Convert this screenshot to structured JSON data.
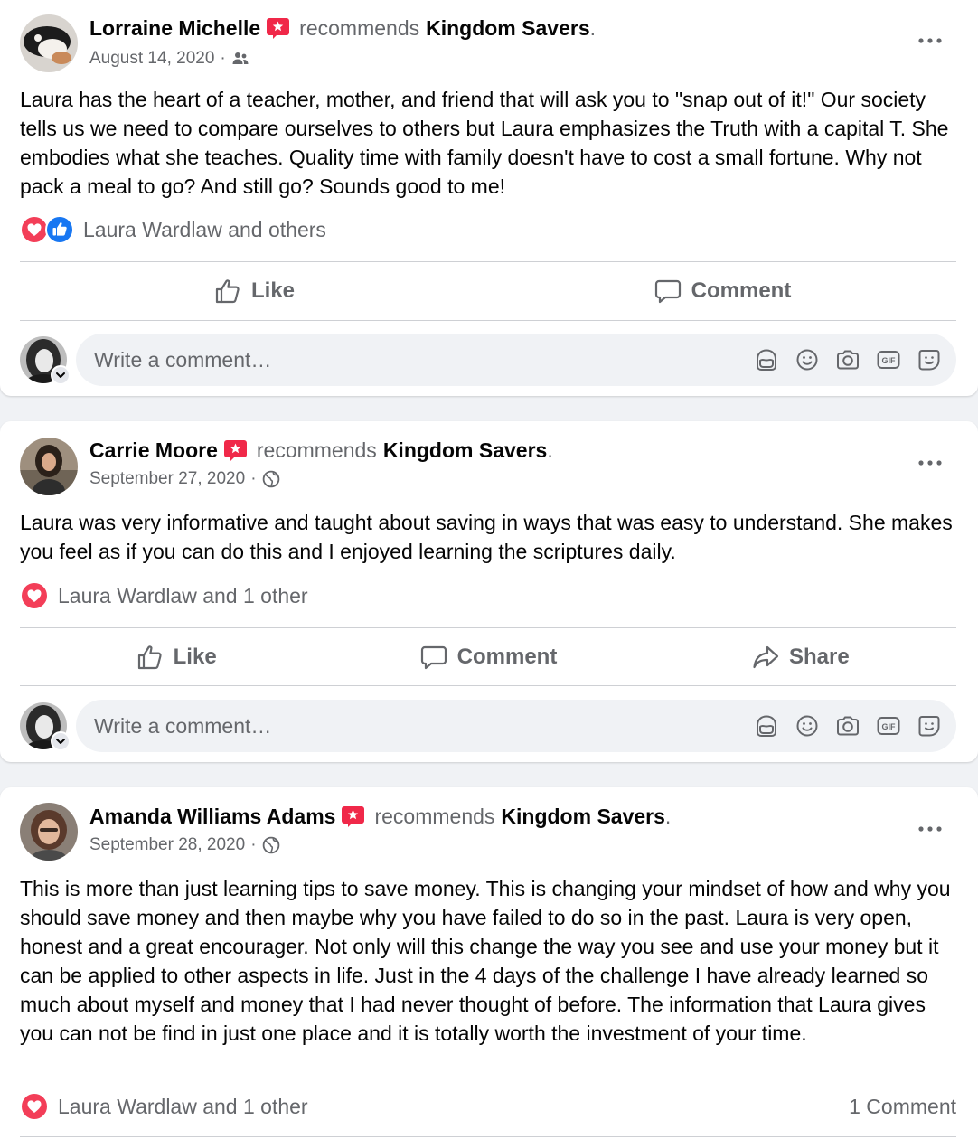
{
  "posts": [
    {
      "author": "Lorraine Michelle",
      "recommends": "recommends",
      "page": "Kingdom Savers",
      "period": ".",
      "date": "August 14, 2020",
      "separator": "·",
      "audience_icon": "friends-icon",
      "text": "Laura has the heart of a teacher, mother, and friend that will ask you to \"snap out of it!\" Our society tells us we need to compare ourselves to others but Laura emphasizes the Truth with a capital T. She embodies what she teaches. Quality time with family doesn't have to cost a small fortune. Why not pack a meal to go? And still go? Sounds good to me!",
      "reactions_text": "Laura Wardlaw and others",
      "reaction_icons": [
        "love-icon",
        "like-icon"
      ],
      "comments_count": "",
      "actions": [
        "Like",
        "Comment"
      ],
      "comment_placeholder": "Write a comment…"
    },
    {
      "author": "Carrie Moore",
      "recommends": "recommends",
      "page": "Kingdom Savers",
      "period": ".",
      "date": "September 27, 2020",
      "separator": "·",
      "audience_icon": "globe-icon",
      "text": "Laura was very informative and taught about saving in ways that was easy to understand. She makes you feel as if you can do this and I enjoyed learning the scriptures daily.",
      "reactions_text": "Laura Wardlaw and 1 other",
      "reaction_icons": [
        "love-icon"
      ],
      "comments_count": "",
      "actions": [
        "Like",
        "Comment",
        "Share"
      ],
      "comment_placeholder": "Write a comment…"
    },
    {
      "author": "Amanda Williams Adams",
      "recommends": "recommends",
      "page": "Kingdom Savers",
      "period": ".",
      "date": "September 28, 2020",
      "separator": "·",
      "audience_icon": "globe-icon",
      "text": "This is more than just learning tips to save money. This is changing your mindset of how and why you should save money and then maybe why you have failed to do so in the past. Laura is very open, honest and a great encourager. Not only will this change the way you see and use your money but it can be applied to other aspects in life. Just in the 4 days of the challenge I have already learned so much about myself and money that I had never thought of before. The information that Laura gives you can not be find in just one place and it is totally worth the investment of your time.",
      "reactions_text": "Laura Wardlaw and 1 other",
      "reaction_icons": [
        "love-icon"
      ],
      "comments_count": "1 Comment",
      "actions": [],
      "comment_placeholder": ""
    }
  ],
  "colors": {
    "love": "#f33e58",
    "like": "#1877f2",
    "recommend_badge": "#f02849",
    "secondary_text": "#65676b",
    "divider": "#ced0d4"
  }
}
